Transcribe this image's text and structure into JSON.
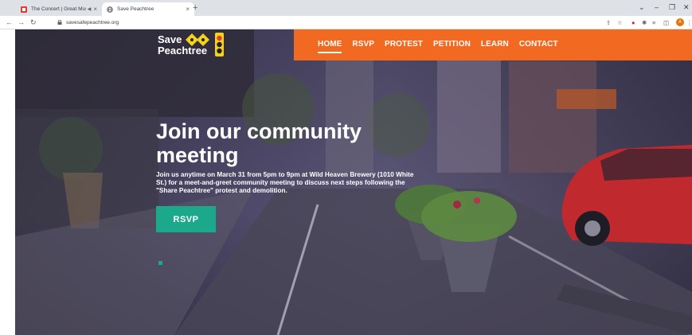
{
  "browser": {
    "tabs": [
      {
        "label": "The Concert | Great Music L",
        "active": false,
        "audio": true
      },
      {
        "label": "Save Peachtree",
        "active": true,
        "audio": false
      }
    ],
    "new_tab": "+",
    "url": "savesafepeachtree.org",
    "profile_initial": "A",
    "icons": [
      "share-icon",
      "star-icon",
      "extension-icon",
      "puzzle-icon",
      "reading-list-icon",
      "sidebar-icon",
      "menu-icon"
    ]
  },
  "site": {
    "logo": {
      "line1": "Save",
      "line2": "Peachtree"
    },
    "nav": [
      {
        "label": "HOME",
        "current": true
      },
      {
        "label": "RSVP",
        "current": false
      },
      {
        "label": "PROTEST",
        "current": false
      },
      {
        "label": "PETITION",
        "current": false
      },
      {
        "label": "LEARN",
        "current": false
      },
      {
        "label": "CONTACT",
        "current": false
      }
    ],
    "hero": {
      "title": "Join our community meeting",
      "description": "Join us anytime on March 31 from 5pm to 9pm at Wild Heaven Brewery (1010 White St.) for a meet-and-greet community meeting to discuss next steps following the \"Share Peachtree\" protest and demolition.",
      "button": "RSVP"
    },
    "colors": {
      "header": "#f26a21",
      "accent": "#1ca88a"
    }
  }
}
